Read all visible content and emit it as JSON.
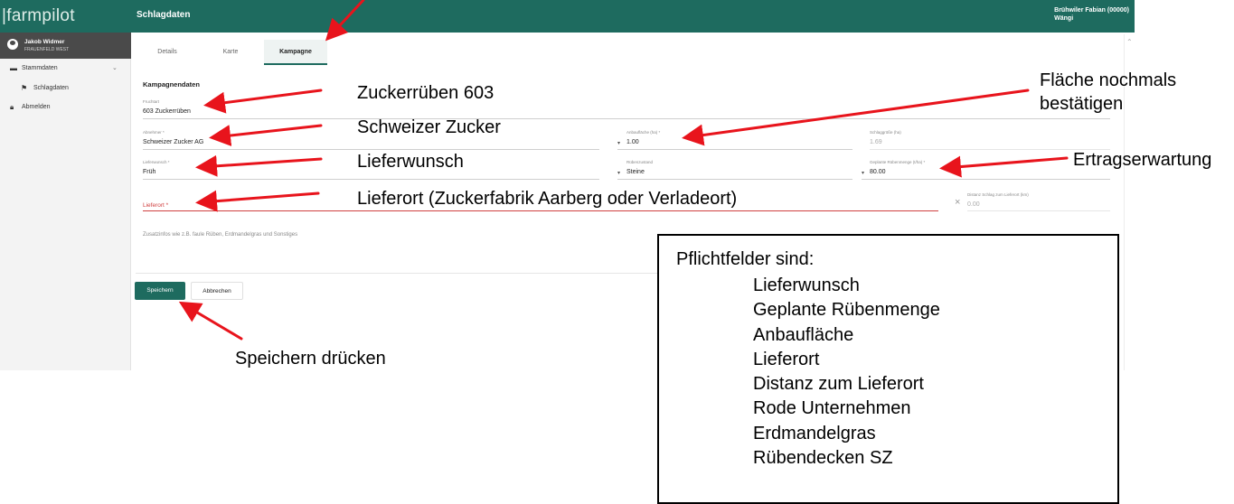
{
  "app": {
    "logo": "|farmpilot",
    "page_title": "Schlagdaten",
    "header_user_line1": "Brühwiler Fabian (00000)",
    "header_user_line2": "Wängi"
  },
  "sidebar": {
    "user_name": "Jakob Widmer",
    "user_org": "FRAUENFELD WEST",
    "items": [
      {
        "label": "Stammdaten",
        "icon": "folder-icon"
      },
      {
        "label": "Schlagdaten",
        "icon": "flag-icon"
      },
      {
        "label": "Abmelden",
        "icon": "lock-icon"
      }
    ]
  },
  "tabs": [
    {
      "label": "Details",
      "active": false
    },
    {
      "label": "Karte",
      "active": false
    },
    {
      "label": "Kampagne",
      "active": true
    }
  ],
  "form": {
    "section_title": "Kampagnendaten",
    "fruchtart": {
      "label": "Fruchtart",
      "value": "603 Zuckerrüben"
    },
    "abnehmer": {
      "label": "Abnehmer *",
      "value": "Schweizer Zucker AG"
    },
    "anbauflaeche": {
      "label": "Anbaufläche (ha) *",
      "value": "1.00"
    },
    "schlaggroesse": {
      "label": "Schlaggröße (ha)",
      "value": "1.69"
    },
    "lieferwunsch": {
      "label": "Lieferwunsch *",
      "value": "Früh"
    },
    "ruebenzustand": {
      "label": "Rübenzustand",
      "value": "Steine"
    },
    "geplante_ruebenmenge": {
      "label": "Geplante Rübenmenge (t/ha) *",
      "value": "80.00"
    },
    "lieferort": {
      "placeholder": "Lieferort *"
    },
    "distanz": {
      "label": "Distanz Schlag zum Lieferort (km)",
      "value": "0.00"
    },
    "zusatzinfos": {
      "placeholder": "Zusatzinfos wie z.B. faule Rüben, Erdmandelgras und Sonstiges"
    }
  },
  "buttons": {
    "save": "Speichern",
    "cancel": "Abbrechen"
  },
  "annotations": {
    "zuckerrueben": "Zuckerrüben 603",
    "schweizer_zucker": "Schweizer Zucker",
    "lieferwunsch": "Lieferwunsch",
    "lieferort": "Lieferort (Zuckerfabrik Aarberg oder Verladeort)",
    "flaeche_line1": "Fläche nochmals",
    "flaeche_line2": "bestätigen",
    "ertrag": "Ertragserwartung",
    "speichern": "Speichern drücken"
  },
  "callout": {
    "heading": "Pflichtfelder sind:",
    "items": [
      "Lieferwunsch",
      "Geplante Rübenmenge",
      "Anbaufläche",
      "Lieferort",
      "Distanz zum Lieferort",
      "Rode Unternehmen",
      "Erdmandelgras",
      "Rübendecken SZ"
    ]
  },
  "colors": {
    "brand": "#1e6b5f",
    "annotation_arrow": "#e8141c",
    "error": "#d04040"
  }
}
